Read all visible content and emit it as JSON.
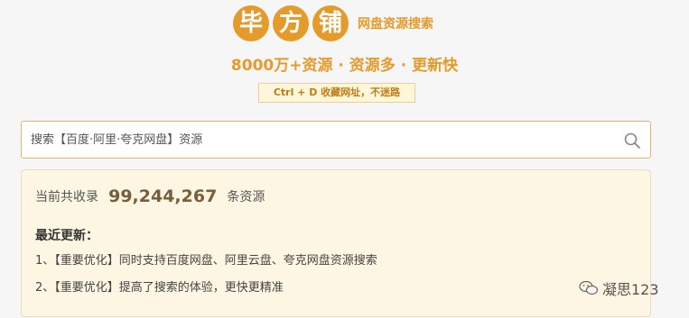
{
  "header": {
    "logo_chars": [
      "毕",
      "方",
      "铺"
    ],
    "logo_subtitle": "网盘资源搜索",
    "slogan": "8000万+资源 · 资源多 · 更新快",
    "bookmark_hint": "Ctrl + D 收藏网址，不迷路"
  },
  "search": {
    "placeholder": "搜索【百度·阿里·夸克网盘】资源",
    "value": "",
    "icon": "search-icon"
  },
  "stats": {
    "prefix": "当前共收录",
    "count": "99,244,267",
    "suffix": "条资源"
  },
  "updates": {
    "title": "最近更新：",
    "items": [
      "1、【重要优化】同时支持百度网盘、阿里云盘、夸克网盘资源搜索",
      "2、【重要优化】提高了搜索的体验，更快更精准"
    ]
  },
  "watermark": {
    "text": "凝思123",
    "icon": "wechat-icon"
  },
  "colors": {
    "accent": "#e59b2c",
    "panel_bg": "#fdf6e3",
    "page_bg": "#f6f6f6"
  }
}
